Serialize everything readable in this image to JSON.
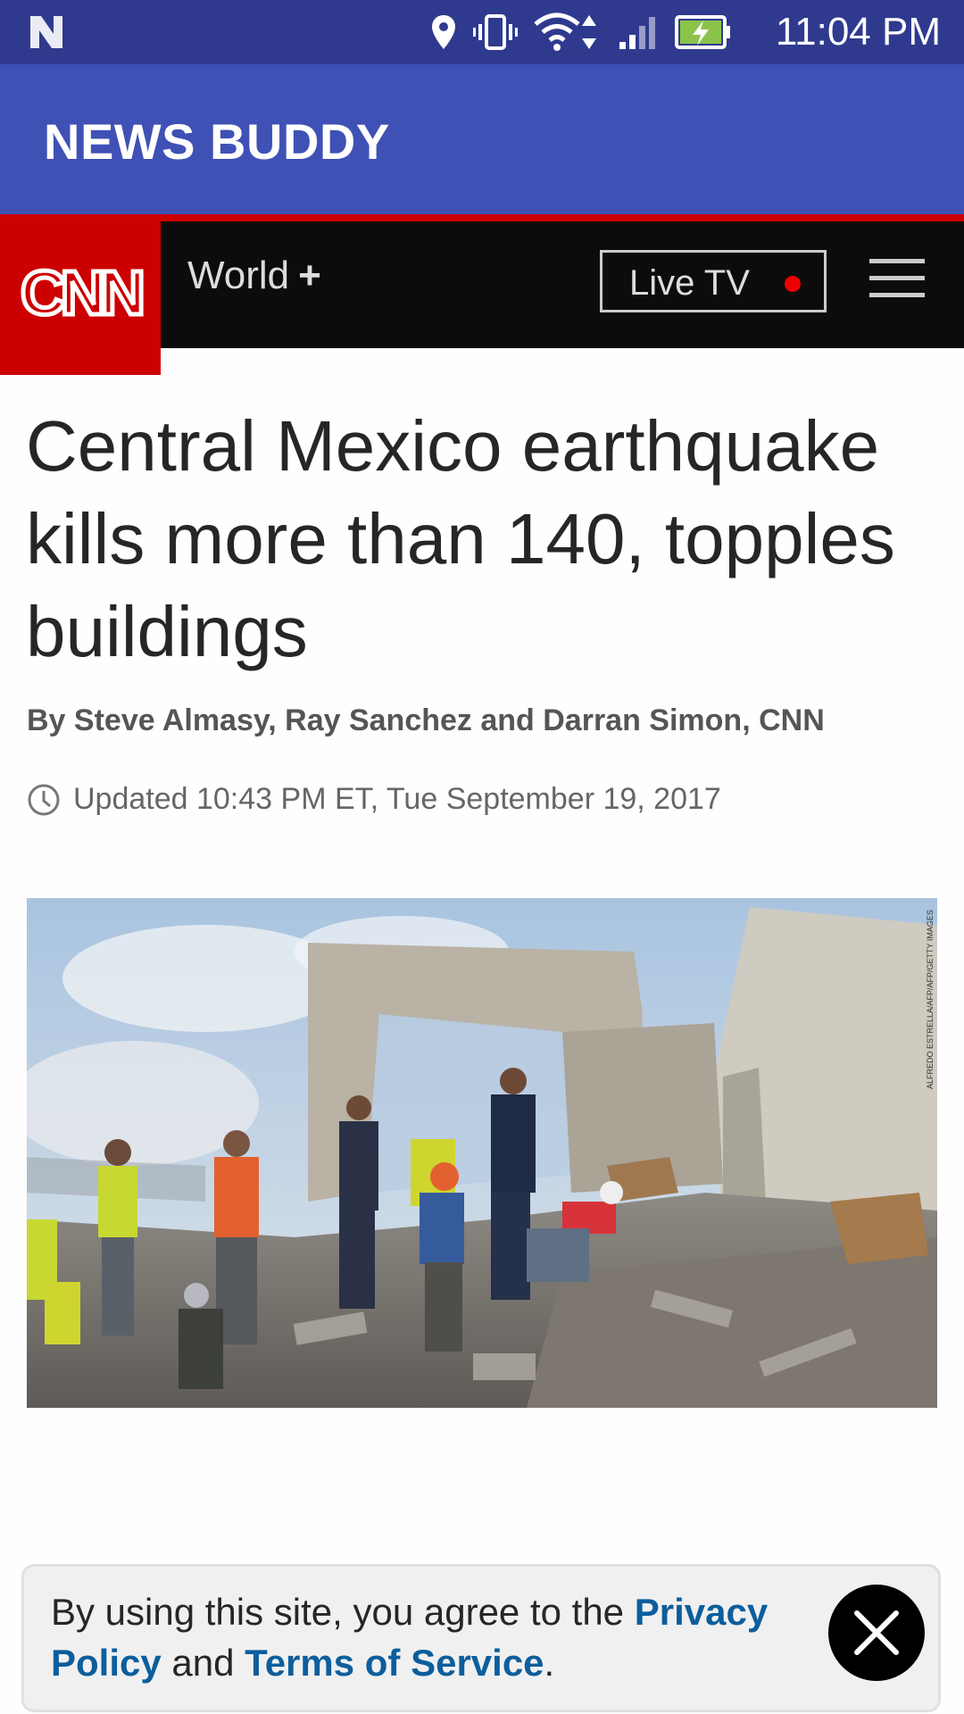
{
  "status_bar": {
    "time": "11:04 PM",
    "icons": [
      "notification-n-icon",
      "location-icon",
      "vibrate-icon",
      "wifi-icon",
      "signal-icon",
      "battery-charging-icon"
    ]
  },
  "app": {
    "title": "NEWS BUDDY"
  },
  "cnn_header": {
    "logo_text": "CNN",
    "section": "World",
    "section_plus": "+",
    "live_tv_label": "Live TV"
  },
  "article": {
    "headline": "Central Mexico earthquake kills more than 140, topples buildings",
    "byline": "By Steve Almasy, Ray Sanchez and Darran Simon, CNN",
    "updated": "Updated 10:43 PM ET, Tue September 19, 2017",
    "photo_credit": "ALFREDO ESTRELLA/AFP/AFP/GETTY IMAGES"
  },
  "consent": {
    "prefix": "By using this site, you agree to the ",
    "privacy_link": "Privacy Policy",
    "middle": " and ",
    "terms_link": "Terms of Service",
    "suffix": "."
  },
  "colors": {
    "status_bar": "#2f3a8f",
    "app_bar": "#3f51b5",
    "cnn_red": "#cc0000",
    "cnn_nav": "#0c0c0c",
    "link": "#0c5e9c"
  }
}
